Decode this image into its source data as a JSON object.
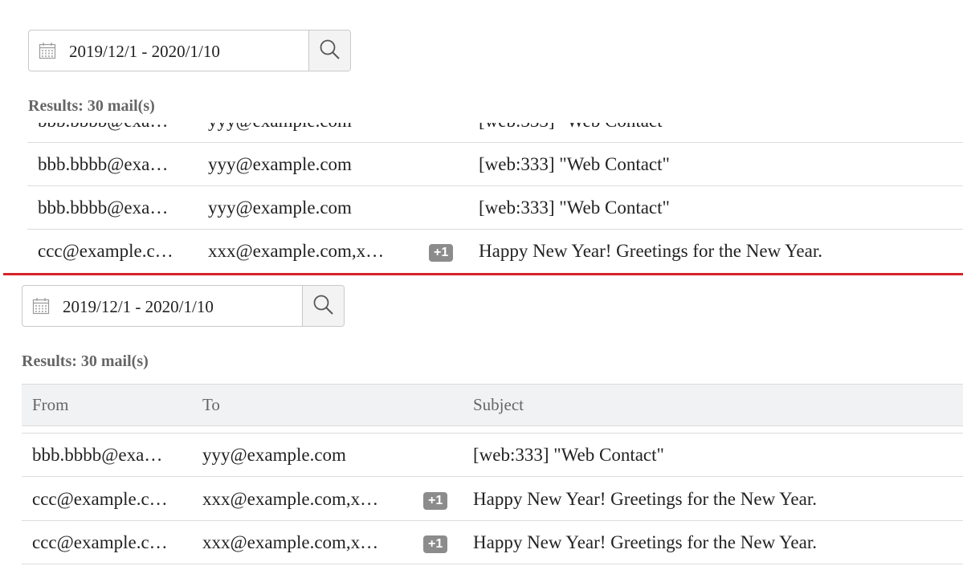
{
  "search": {
    "date_range": "2019/12/1 - 2020/1/10",
    "icons": {
      "calendar": "calendar-icon",
      "search": "search-icon"
    }
  },
  "results_label": "Results: 30 mail(s)",
  "columns": {
    "from": "From",
    "to": "To",
    "subject": "Subject"
  },
  "top_rows": [
    {
      "from": "bbb.bbbb@exa…",
      "to": "yyy@example.com",
      "badge": "",
      "subject": "[web:333] \"Web Contact\""
    },
    {
      "from": "bbb.bbbb@exa…",
      "to": "yyy@example.com",
      "badge": "",
      "subject": "[web:333] \"Web Contact\""
    },
    {
      "from": "ccc@example.c…",
      "to": "xxx@example.com,x…",
      "badge": "+1",
      "subject": "Happy New Year! Greetings for the New Year."
    }
  ],
  "bottom_rows": [
    {
      "from": "bbb.bbbb@exa…",
      "to": "yyy@example.com",
      "badge": "",
      "subject": "[web:333] \"Web Contact\""
    },
    {
      "from": "ccc@example.c…",
      "to": "xxx@example.com,x…",
      "badge": "+1",
      "subject": "Happy New Year! Greetings for the New Year."
    },
    {
      "from": "ccc@example.c…",
      "to": "xxx@example.com,x…",
      "badge": "+1",
      "subject": "Happy New Year! Greetings for the New Year."
    }
  ],
  "colors": {
    "divider": "#d8232a",
    "badge": "#8c8c8c",
    "header_bg": "#f1f2f3"
  }
}
